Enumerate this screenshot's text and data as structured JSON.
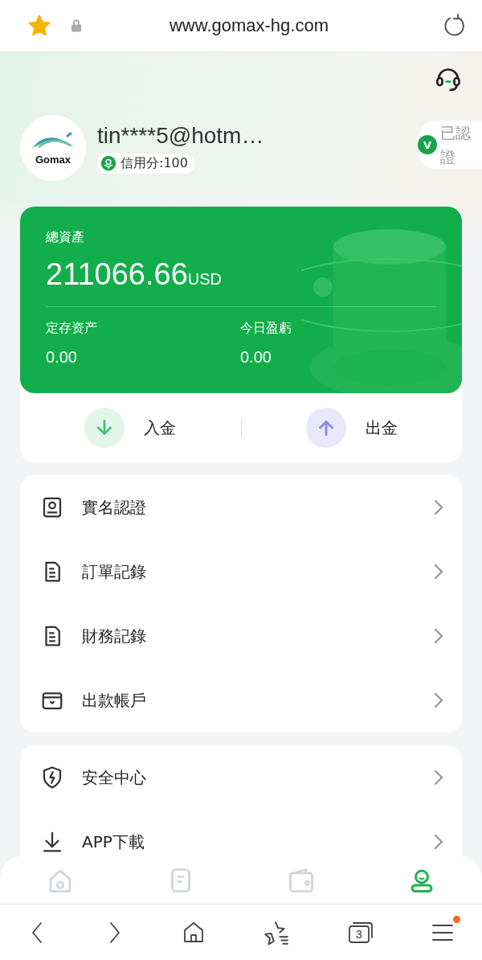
{
  "browser_bar": {
    "url": "www.gomax-hg.com",
    "bookmarked": true
  },
  "profile": {
    "logo_text": "Gomax",
    "account": "tin****5@hotm…",
    "credit": "信用分:100",
    "verified_mark": "V",
    "verified_label": "已認證"
  },
  "assets": {
    "title": "總資產",
    "amount": "211066.66",
    "currency": "USD",
    "stats": [
      {
        "label": "定存资产",
        "value": "0.00"
      },
      {
        "label": "今日盈虧",
        "value": "0.00"
      }
    ]
  },
  "actions": [
    {
      "kind": "deposit",
      "label": "入金"
    },
    {
      "kind": "withdraw",
      "label": "出金"
    }
  ],
  "menu": [
    {
      "kind": "id-card",
      "label": "實名認證"
    },
    {
      "kind": "doc",
      "label": "訂單記錄"
    },
    {
      "kind": "doc",
      "label": "財務記錄"
    },
    {
      "kind": "wallet",
      "label": "出款帳戶"
    }
  ],
  "menu2": [
    {
      "kind": "shield",
      "label": "安全中心"
    },
    {
      "kind": "download",
      "label": "APP下載"
    }
  ],
  "tab_bar": [
    {
      "kind": "home",
      "selected": false
    },
    {
      "kind": "note",
      "selected": false
    },
    {
      "kind": "wallet",
      "selected": false
    },
    {
      "kind": "user",
      "selected": true
    }
  ],
  "browser_nav": {
    "tab_count": "3",
    "menu_badge": true
  }
}
